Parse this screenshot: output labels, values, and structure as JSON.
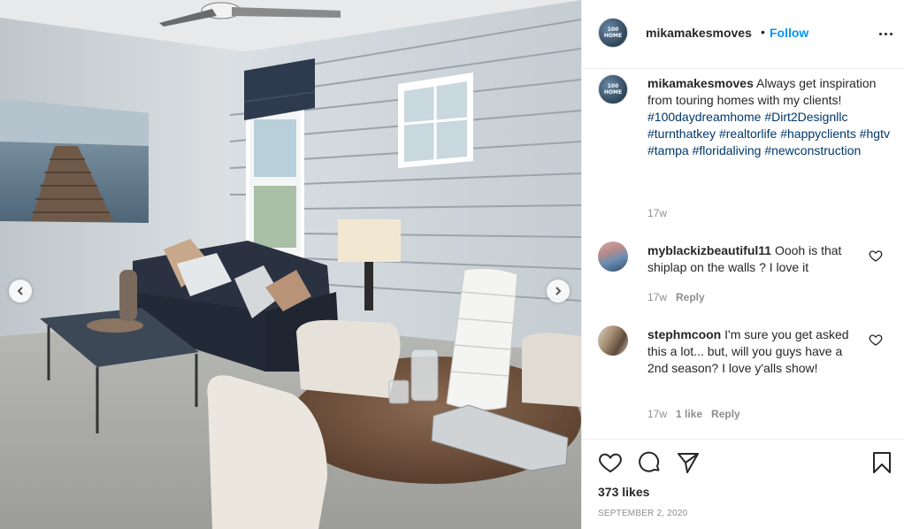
{
  "post": {
    "author": "mikamakesmoves",
    "avatar_text": "100 HOME",
    "follow_label": "Follow",
    "separator": "•",
    "caption_text": "Always get inspiration from touring homes with my clients!",
    "hashtags": [
      "#100daydreamhome",
      "#Dirt2Designllc",
      "#turnthatkey",
      "#realtorlife",
      "#happyclients",
      "#hgtv",
      "#tampa",
      "#floridaliving",
      "#newconstruction"
    ],
    "caption_age": "17w",
    "likes": "373 likes",
    "date": "SEPTEMBER 2, 2020"
  },
  "comments": [
    {
      "user": "myblackizbeautiful11",
      "text": "Oooh is that shiplap on the walls ? I love it",
      "age": "17w",
      "likes": "",
      "reply_label": "Reply"
    },
    {
      "user": "stephmcoon",
      "text": "I'm sure you get asked this a lot... but, will you guys have a 2nd season? I love y'alls show!",
      "age": "17w",
      "likes": "1 like",
      "reply_label": "Reply"
    }
  ],
  "icons": {
    "more": "more-options-icon",
    "like": "heart-icon",
    "comment": "comment-bubble-icon",
    "share": "paper-plane-icon",
    "save": "bookmark-icon",
    "prev": "chevron-left-icon",
    "next": "chevron-right-icon"
  },
  "colors": {
    "link_blue": "#0095f6",
    "hashtag": "#00376b",
    "muted": "#8e8e8e",
    "text": "#262626"
  }
}
